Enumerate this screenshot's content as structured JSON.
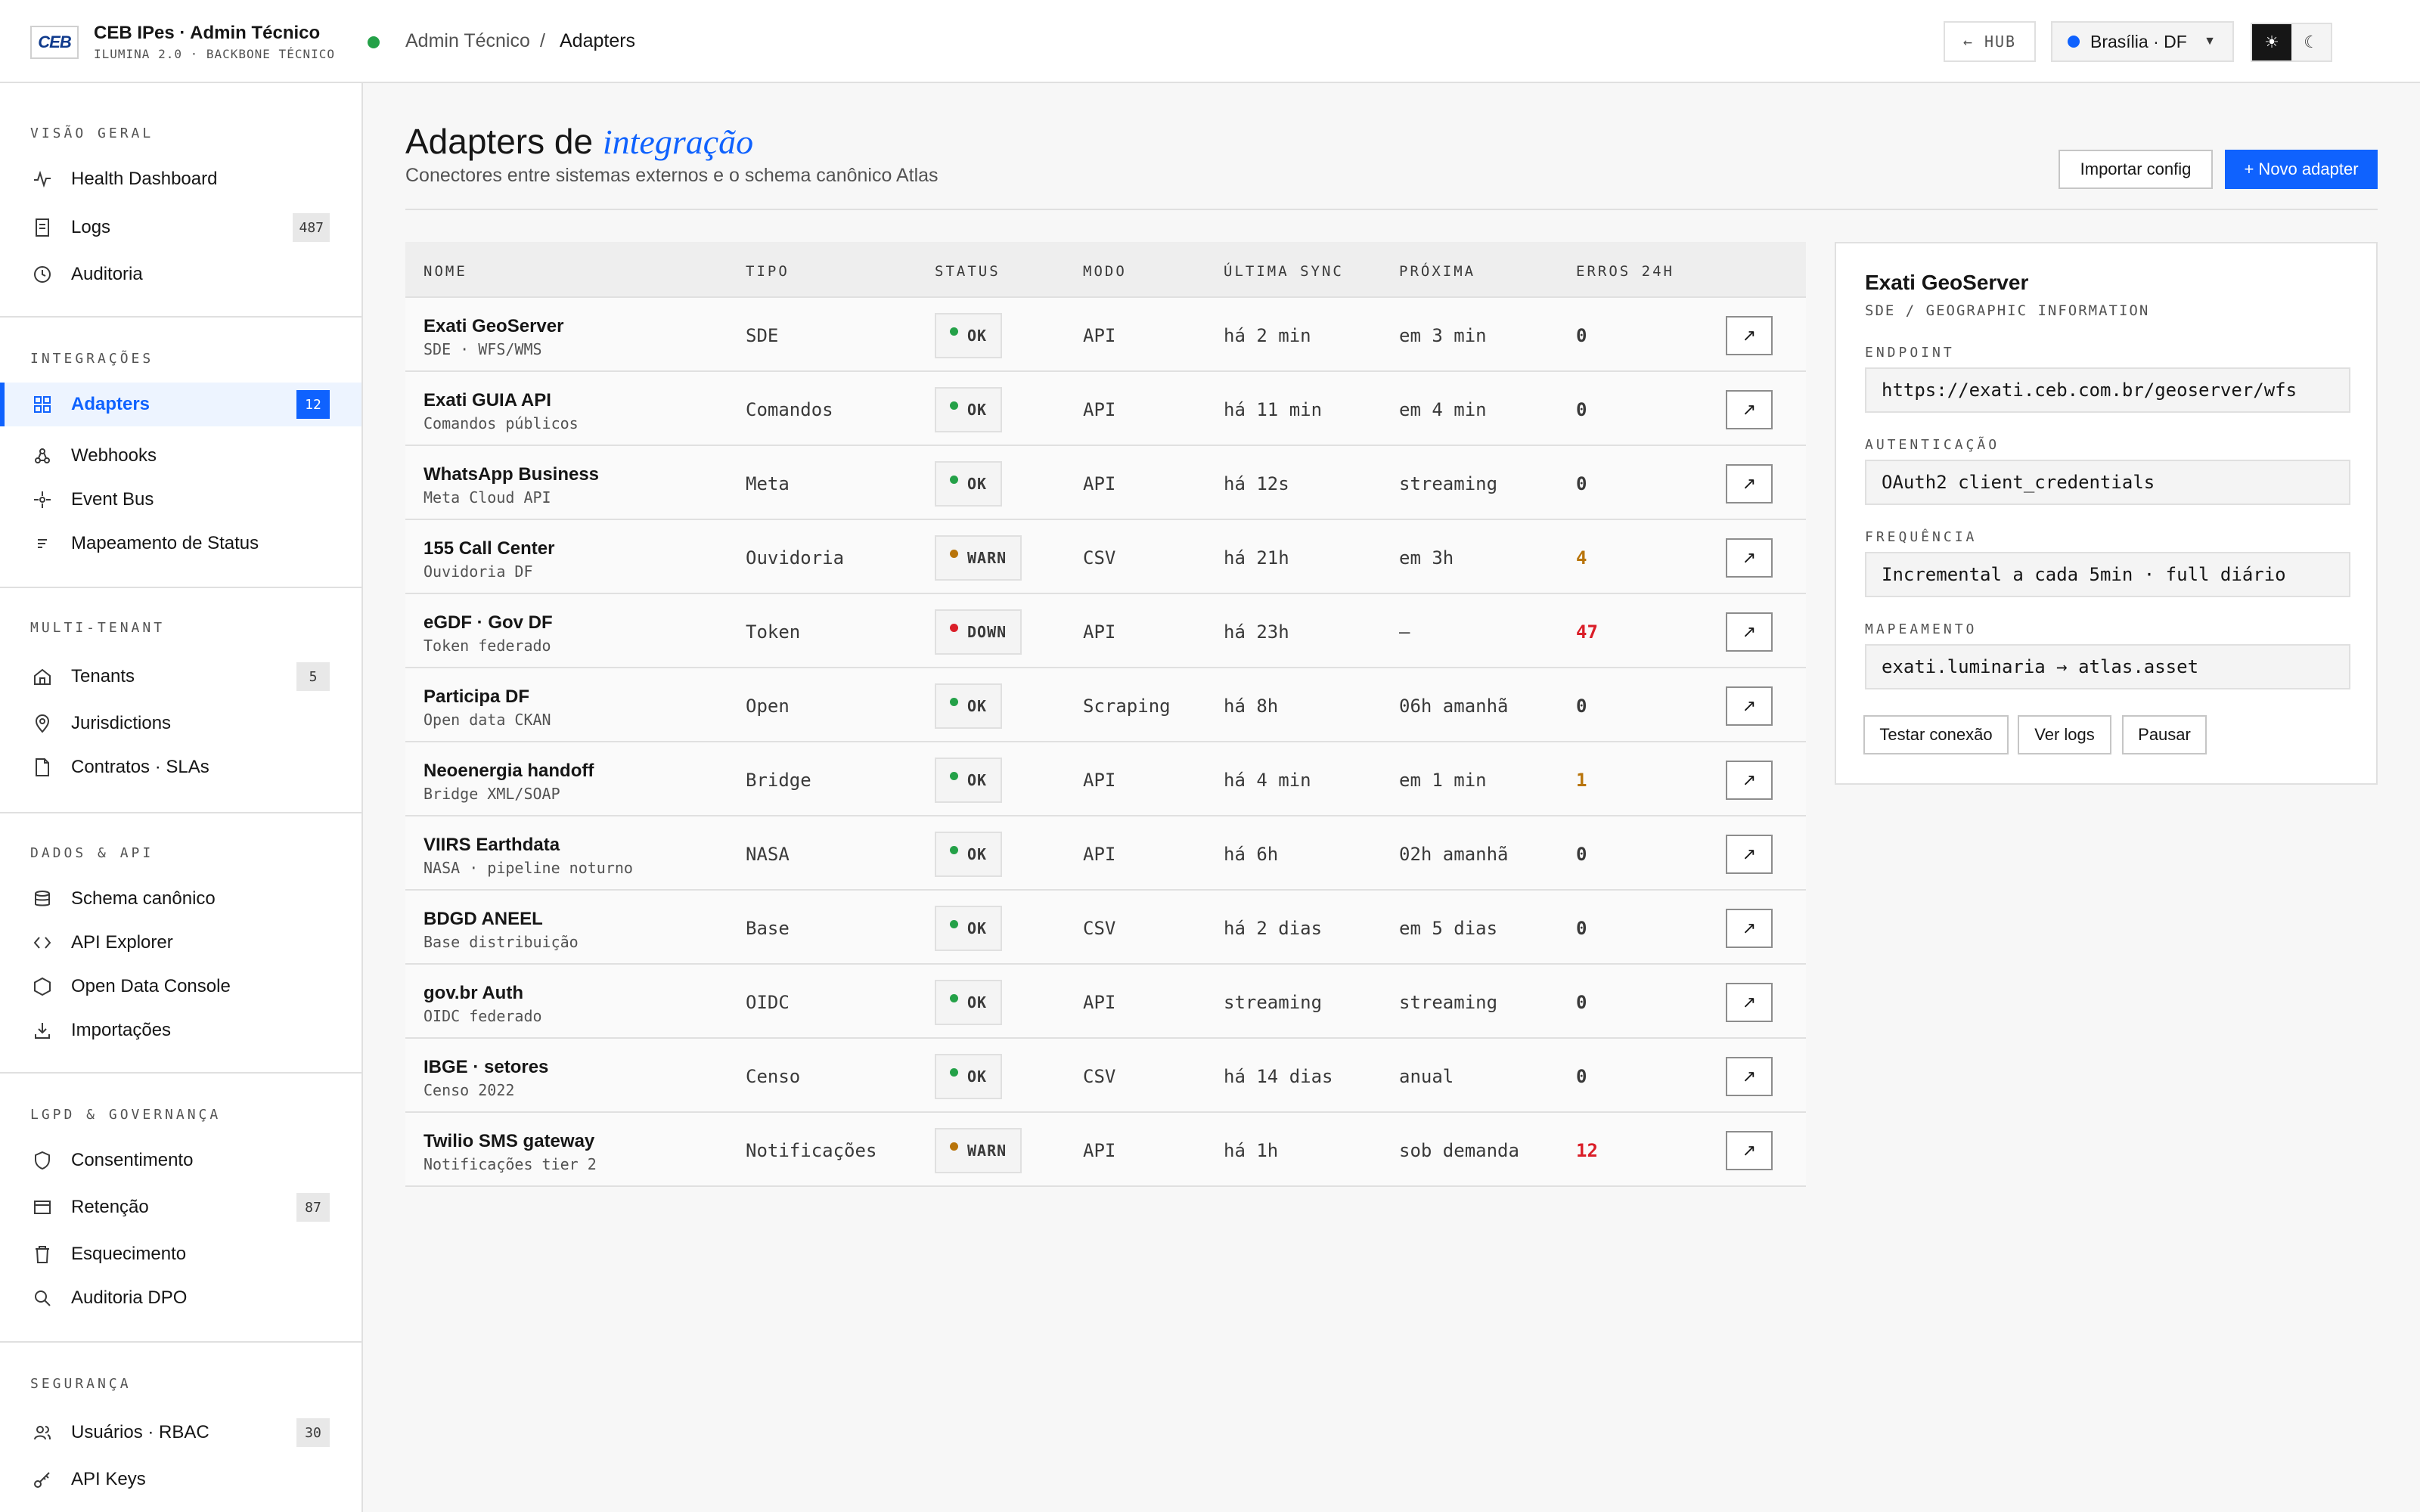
{
  "header": {
    "logo_text": "CEB",
    "app_title": "CEB IPes · Admin Técnico",
    "app_subtitle": "ILUMINA 2.0 · BACKBONE TÉCNICO",
    "breadcrumb": [
      "Admin Técnico",
      "Adapters"
    ],
    "breadcrumb_sep": "/",
    "hub_label": "← HUB",
    "region_label": "Brasília · DF",
    "region_caret": "▼",
    "theme_light": "☀",
    "theme_dark": "☾"
  },
  "sidebar": {
    "sections": [
      {
        "title": "VISÃO GERAL",
        "items": [
          {
            "label": "Health Dashboard",
            "icon": "activity-icon"
          },
          {
            "label": "Logs",
            "icon": "document-icon",
            "count": "487"
          },
          {
            "label": "Auditoria",
            "icon": "clock-icon"
          }
        ]
      },
      {
        "title": "INTEGRAÇÕES",
        "items": [
          {
            "label": "Adapters",
            "icon": "grid-icon",
            "count": "12",
            "active": true
          },
          {
            "label": "Webhooks",
            "icon": "webhook-icon"
          },
          {
            "label": "Event Bus",
            "icon": "event-bus-icon"
          },
          {
            "label": "Mapeamento de Status",
            "icon": "list-icon"
          }
        ]
      },
      {
        "title": "MULTI-TENANT",
        "items": [
          {
            "label": "Tenants",
            "icon": "home-icon",
            "count": "5"
          },
          {
            "label": "Jurisdictions",
            "icon": "location-pin-icon"
          },
          {
            "label": "Contratos · SLAs",
            "icon": "contract-icon"
          }
        ]
      },
      {
        "title": "DADOS & API",
        "items": [
          {
            "label": "Schema canônico",
            "icon": "database-icon"
          },
          {
            "label": "API Explorer",
            "icon": "code-icon"
          },
          {
            "label": "Open Data Console",
            "icon": "hexagon-icon"
          },
          {
            "label": "Importações",
            "icon": "download-icon"
          }
        ]
      },
      {
        "title": "LGPD & GOVERNANÇA",
        "items": [
          {
            "label": "Consentimento",
            "icon": "shield-icon"
          },
          {
            "label": "Retenção",
            "icon": "card-icon",
            "count": "87"
          },
          {
            "label": "Esquecimento",
            "icon": "trash-icon"
          },
          {
            "label": "Auditoria DPO",
            "icon": "search-icon"
          }
        ]
      },
      {
        "title": "SEGURANÇA",
        "items": [
          {
            "label": "Usuários · RBAC",
            "icon": "users-icon",
            "count": "30"
          },
          {
            "label": "API Keys",
            "icon": "key-icon"
          }
        ]
      }
    ]
  },
  "main": {
    "title_plain": "Adapters de",
    "title_emph": "integração",
    "subtitle": "Conectores entre sistemas externos e o schema canônico Atlas",
    "import_button": "Importar config",
    "new_button": "+ Novo adapter",
    "columns": [
      "NOME",
      "TIPO",
      "STATUS",
      "MODO",
      "ÚLTIMA SYNC",
      "PRÓXIMA",
      "ERROS 24H"
    ],
    "open_glyph": "↗",
    "rows": [
      {
        "name": "Exati GeoServer",
        "sub": "SDE · WFS/WMS",
        "type": "SDE",
        "status": "OK",
        "mode": "API",
        "last": "há 2 min",
        "next": "em 3 min",
        "errors": "0"
      },
      {
        "name": "Exati GUIA API",
        "sub": "Comandos públicos",
        "type": "Comandos",
        "status": "OK",
        "mode": "API",
        "last": "há 11 min",
        "next": "em 4 min",
        "errors": "0"
      },
      {
        "name": "WhatsApp Business",
        "sub": "Meta Cloud API",
        "type": "Meta",
        "status": "OK",
        "mode": "API",
        "last": "há 12s",
        "next": "streaming",
        "errors": "0"
      },
      {
        "name": "155 Call Center",
        "sub": "Ouvidoria DF",
        "type": "Ouvidoria",
        "status": "WARN",
        "mode": "CSV",
        "last": "há 21h",
        "next": "em 3h",
        "errors": "4"
      },
      {
        "name": "eGDF · Gov DF",
        "sub": "Token federado",
        "type": "Token",
        "status": "DOWN",
        "mode": "API",
        "last": "há 23h",
        "next": "—",
        "errors": "47"
      },
      {
        "name": "Participa DF",
        "sub": "Open data CKAN",
        "type": "Open",
        "status": "OK",
        "mode": "Scraping",
        "last": "há 8h",
        "next": "06h amanhã",
        "errors": "0"
      },
      {
        "name": "Neoenergia handoff",
        "sub": "Bridge XML/SOAP",
        "type": "Bridge",
        "status": "OK",
        "mode": "API",
        "last": "há 4 min",
        "next": "em 1 min",
        "errors": "1"
      },
      {
        "name": "VIIRS Earthdata",
        "sub": "NASA · pipeline noturno",
        "type": "NASA",
        "status": "OK",
        "mode": "API",
        "last": "há 6h",
        "next": "02h amanhã",
        "errors": "0"
      },
      {
        "name": "BDGD ANEEL",
        "sub": "Base distribuição",
        "type": "Base",
        "status": "OK",
        "mode": "CSV",
        "last": "há 2 dias",
        "next": "em 5 dias",
        "errors": "0"
      },
      {
        "name": "gov.br Auth",
        "sub": "OIDC federado",
        "type": "OIDC",
        "status": "OK",
        "mode": "API",
        "last": "streaming",
        "next": "streaming",
        "errors": "0"
      },
      {
        "name": "IBGE · setores",
        "sub": "Censo 2022",
        "type": "Censo",
        "status": "OK",
        "mode": "CSV",
        "last": "há 14 dias",
        "next": "anual",
        "errors": "0"
      },
      {
        "name": "Twilio SMS gateway",
        "sub": "Notificações tier 2",
        "type": "Notificações",
        "status": "WARN",
        "mode": "API",
        "last": "há 1h",
        "next": "sob demanda",
        "errors": "12"
      }
    ]
  },
  "detail": {
    "title": "Exati GeoServer",
    "subtitle": "SDE / GEOGRAPHIC INFORMATION",
    "fields": [
      {
        "label": "ENDPOINT",
        "value": "https://exati.ceb.com.br/geoserver/wfs"
      },
      {
        "label": "AUTENTICAÇÃO",
        "value": "OAuth2 client_credentials"
      },
      {
        "label": "FREQUÊNCIA",
        "value": "Incremental a cada 5min · full diário"
      },
      {
        "label": "MAPEAMENTO",
        "value": "exati.luminaria → atlas.asset"
      }
    ],
    "buttons": [
      "Testar conexão",
      "Ver logs",
      "Pausar"
    ]
  },
  "colors": {
    "accent": "#0f62fe",
    "ok": "#24a148",
    "warn": "#b8740a",
    "down": "#da1e28",
    "error_warn_text": "#b8740a",
    "error_down_text": "#da1e28"
  }
}
